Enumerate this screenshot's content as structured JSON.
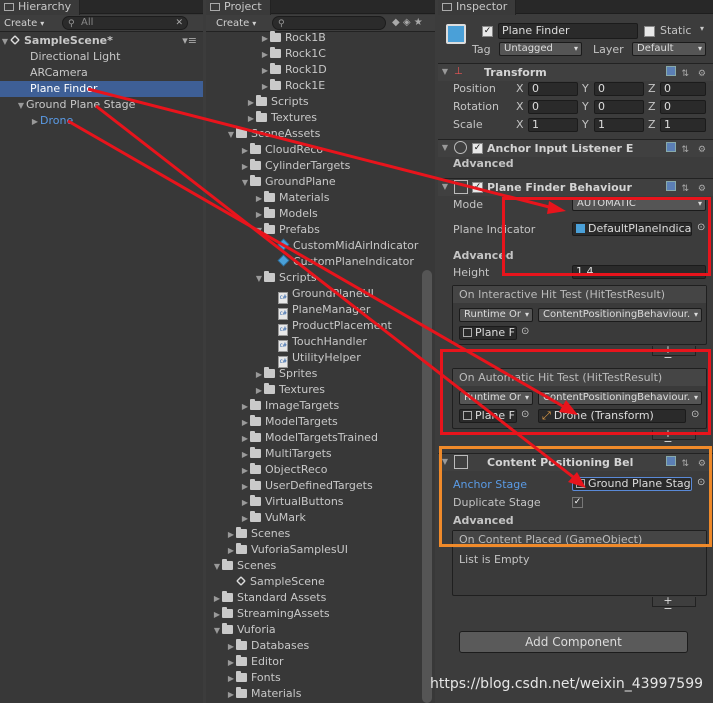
{
  "hierarchy": {
    "tab": "Hierarchy",
    "create": "Create",
    "search_placeholder": "All",
    "scene": "SampleScene*",
    "items": [
      {
        "label": "Directional Light"
      },
      {
        "label": "ARCamera"
      },
      {
        "label": "Plane Finder"
      },
      {
        "label": "Ground Plane Stage"
      },
      {
        "label": "Drone"
      }
    ]
  },
  "project": {
    "tab": "Project",
    "create": "Create",
    "tree": [
      {
        "label": "Rock1B"
      },
      {
        "label": "Rock1C"
      },
      {
        "label": "Rock1D"
      },
      {
        "label": "Rock1E"
      },
      {
        "label": "Scripts"
      },
      {
        "label": "Textures"
      },
      {
        "label": "SceneAssets"
      },
      {
        "label": "CloudReco"
      },
      {
        "label": "CylinderTargets"
      },
      {
        "label": "GroundPlane"
      },
      {
        "label": "Materials"
      },
      {
        "label": "Models"
      },
      {
        "label": "Prefabs"
      },
      {
        "label": "CustomMidAirIndicator"
      },
      {
        "label": "CustomPlaneIndicator"
      },
      {
        "label": "Scripts"
      },
      {
        "label": "GroundPlaneUI"
      },
      {
        "label": "PlaneManager"
      },
      {
        "label": "ProductPlacement"
      },
      {
        "label": "TouchHandler"
      },
      {
        "label": "UtilityHelper"
      },
      {
        "label": "Sprites"
      },
      {
        "label": "Textures"
      },
      {
        "label": "ImageTargets"
      },
      {
        "label": "ModelTargets"
      },
      {
        "label": "ModelTargetsTrained"
      },
      {
        "label": "MultiTargets"
      },
      {
        "label": "ObjectReco"
      },
      {
        "label": "UserDefinedTargets"
      },
      {
        "label": "VirtualButtons"
      },
      {
        "label": "VuMark"
      },
      {
        "label": "Scenes"
      },
      {
        "label": "VuforiaSamplesUI"
      },
      {
        "label": "Scenes"
      },
      {
        "label": "SampleScene"
      },
      {
        "label": "Standard Assets"
      },
      {
        "label": "StreamingAssets"
      },
      {
        "label": "Vuforia"
      },
      {
        "label": "Databases"
      },
      {
        "label": "Editor"
      },
      {
        "label": "Fonts"
      },
      {
        "label": "Materials"
      }
    ]
  },
  "inspector": {
    "tab": "Inspector",
    "object_name": "Plane Finder",
    "static_label": "Static",
    "tag_label": "Tag",
    "tag_value": "Untagged",
    "layer_label": "Layer",
    "layer_value": "Default",
    "transform": {
      "title": "Transform",
      "position": {
        "label": "Position",
        "x": "0",
        "y": "0",
        "z": "0"
      },
      "rotation": {
        "label": "Rotation",
        "x": "0",
        "y": "0",
        "z": "0"
      },
      "scale": {
        "label": "Scale",
        "x": "1",
        "y": "1",
        "z": "1"
      },
      "x": "X",
      "y": "Y",
      "z": "Z"
    },
    "anchor_listener": {
      "title": "Anchor Input Listener E",
      "advanced": "Advanced"
    },
    "plane_finder": {
      "title": "Plane Finder Behaviour",
      "mode_label": "Mode",
      "mode_value": "AUTOMATIC",
      "indicator_label": "Plane Indicator",
      "indicator_value": "DefaultPlaneIndica",
      "advanced": "Advanced",
      "height_label": "Height",
      "height_value": "1.4",
      "interactive_event": "On Interactive Hit Test (HitTestResult)",
      "runtime": "Runtime Or",
      "function": "ContentPositioningBehaviour.",
      "interactive_target": "Plane F",
      "automatic_event": "On Automatic Hit Test (HitTestResult)",
      "automatic_target": "Plane F",
      "automatic_arg": "Drone (Transform)"
    },
    "content_positioning": {
      "title": "Content Positioning Bel",
      "anchor_label": "Anchor Stage",
      "anchor_value": "Ground Plane Stag",
      "duplicate_label": "Duplicate Stage",
      "advanced": "Advanced",
      "placed_event": "On Content Placed (GameObject)",
      "empty": "List is Empty"
    },
    "add_component": "Add Component"
  },
  "watermark": "https://blog.csdn.net/weixin_43997599",
  "colors": {
    "highlight_red": "#e8141c",
    "highlight_orange": "#f08a2a",
    "selection": "#3e5f96",
    "link_blue": "#5a9be6"
  }
}
